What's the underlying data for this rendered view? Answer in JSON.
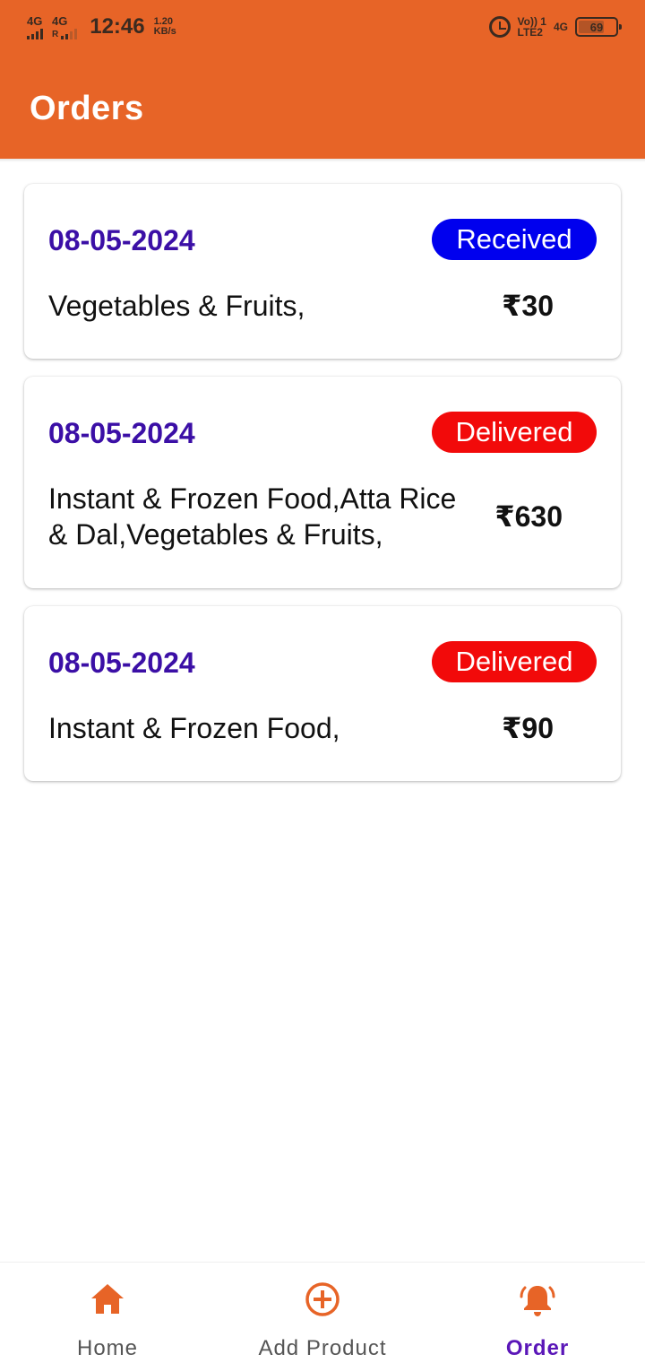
{
  "status_bar": {
    "net1": "4G",
    "net2": "4G",
    "net2_sub": "R",
    "time": "12:46",
    "speed_value": "1.20",
    "speed_unit": "KB/s",
    "volte_top": "Vo)) 1",
    "volte_bottom": "LTE2",
    "net3": "4G",
    "battery": "69",
    "battery_level": 0.69
  },
  "header": {
    "title": "Orders"
  },
  "orders": [
    {
      "date": "08-05-2024",
      "status": "Received",
      "items": "Vegetables & Fruits,",
      "total": "₹30"
    },
    {
      "date": "08-05-2024",
      "status": "Delivered",
      "items": "Instant & Frozen Food,Atta Rice & Dal,Vegetables & Fruits,",
      "total": "₹630"
    },
    {
      "date": "08-05-2024",
      "status": "Delivered",
      "items": "Instant & Frozen Food,",
      "total": "₹90"
    }
  ],
  "colors": {
    "brand": "#e76427",
    "date": "#3b0fa6",
    "status_received": "#0000ee",
    "status_delivered": "#f20a0a",
    "nav_active": "#5a16b8"
  },
  "bottom_nav": {
    "items": [
      {
        "label": "Home",
        "icon": "home-icon"
      },
      {
        "label": "Add Product",
        "icon": "add-circle-icon"
      },
      {
        "label": "Order",
        "icon": "bell-icon",
        "active": true
      }
    ]
  }
}
